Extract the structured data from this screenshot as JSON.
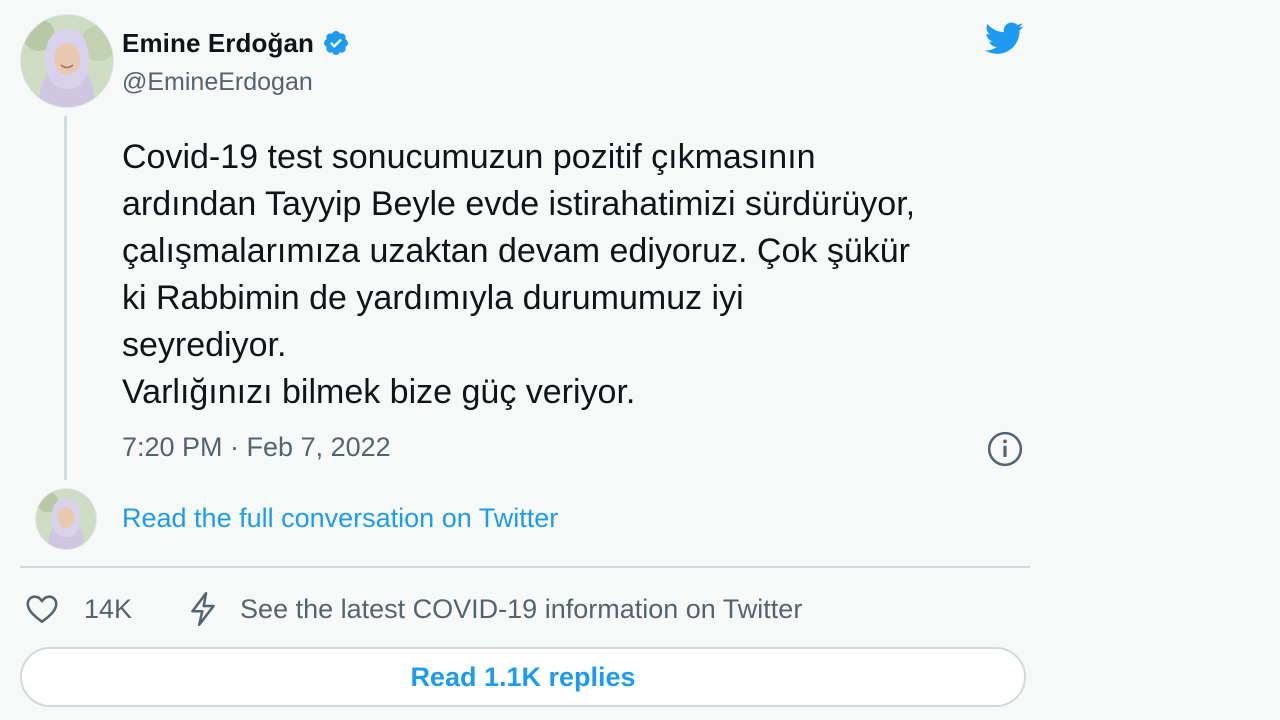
{
  "author": {
    "name": "Emine Erdoğan",
    "handle": "@EmineErdogan",
    "verified": true,
    "avatar": "profile-photo"
  },
  "tweet": {
    "lines": [
      "Covid-19 test sonucumuzun pozitif çıkmasının",
      "ardından Tayyip Beyle evde istirahatimizi sürdürüyor,",
      "çalışmalarımıza uzaktan devam ediyoruz. Çok şükür",
      "ki Rabbimin de yardımıyla durumumuz iyi",
      "seyrediyor.",
      "Varlığınızı bilmek bize güç veriyor."
    ],
    "timestamp": "7:20 PM · Feb 7, 2022"
  },
  "conversation_link": "Read the full conversation on Twitter",
  "actions": {
    "like_count": "14K",
    "covid_info": "See the latest COVID-19 information on Twitter"
  },
  "read_replies_label": "Read 1.1K replies",
  "icons": {
    "brand": "twitter-bird-icon",
    "verified": "verified-badge-icon",
    "info": "info-icon",
    "like": "heart-icon",
    "covid": "lightning-bolt-icon"
  },
  "colors": {
    "accent": "#1d9bf0",
    "text": "#0f1419",
    "secondary_text": "#536471",
    "border": "#cfd9de",
    "background": "#f7f9f9"
  }
}
